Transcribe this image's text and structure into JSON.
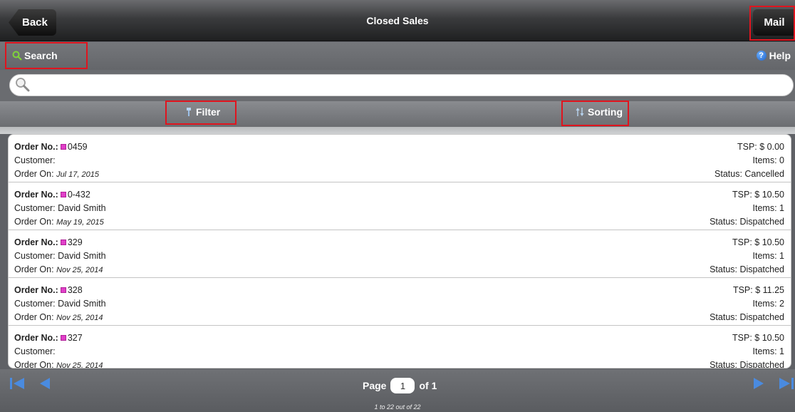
{
  "header": {
    "back_label": "Back",
    "title": "Closed Sales",
    "mail_label": "Mail"
  },
  "search_bar": {
    "search_label": "Search",
    "help_label": "Help",
    "input_value": "",
    "input_placeholder": ""
  },
  "toolbar": {
    "filter_label": "Filter",
    "sorting_label": "Sorting"
  },
  "orders": [
    {
      "order_label": "Order No.:",
      "order_no": "0459",
      "customer_label": "Customer:",
      "customer": "",
      "order_on_label": "Order On:",
      "date": "Jul 17, 2015",
      "tsp": "TSP: $ 0.00",
      "items": "Items: 0",
      "status": "Status: Cancelled"
    },
    {
      "order_label": "Order No.:",
      "order_no": "0-432",
      "customer_label": "Customer:",
      "customer": "David Smith",
      "order_on_label": "Order On:",
      "date": "May 19, 2015",
      "tsp": "TSP: $ 10.50",
      "items": "Items: 1",
      "status": "Status: Dispatched"
    },
    {
      "order_label": "Order No.:",
      "order_no": "329",
      "customer_label": "Customer:",
      "customer": "David Smith",
      "order_on_label": "Order On:",
      "date": "Nov 25, 2014",
      "tsp": "TSP: $ 10.50",
      "items": "Items: 1",
      "status": "Status: Dispatched"
    },
    {
      "order_label": "Order No.:",
      "order_no": "328",
      "customer_label": "Customer:",
      "customer": "David Smith",
      "order_on_label": "Order On:",
      "date": "Nov 25, 2014",
      "tsp": "TSP: $ 11.25",
      "items": "Items: 2",
      "status": "Status: Dispatched"
    },
    {
      "order_label": "Order No.:",
      "order_no": "327",
      "customer_label": "Customer:",
      "customer": "",
      "order_on_label": "Order On:",
      "date": "Nov 25, 2014",
      "tsp": "TSP: $ 10.50",
      "items": "Items: 1",
      "status": "Status: Dispatched"
    }
  ],
  "pager": {
    "page_label": "Page",
    "page_value": "1",
    "of_label": "of 1",
    "range_text": "1 to 22 out of 22"
  },
  "icons": {
    "first_page": "first-page-icon",
    "prev_page": "prev-page-icon",
    "next_page": "next-page-icon",
    "last_page": "last-page-icon",
    "search": "search-icon",
    "help": "help-icon",
    "filter": "filter-icon",
    "sorting": "sort-icon"
  },
  "colors": {
    "highlight": "#e0141e",
    "order_marker": "#e040c8",
    "pager_arrows": "#4a8be0"
  }
}
